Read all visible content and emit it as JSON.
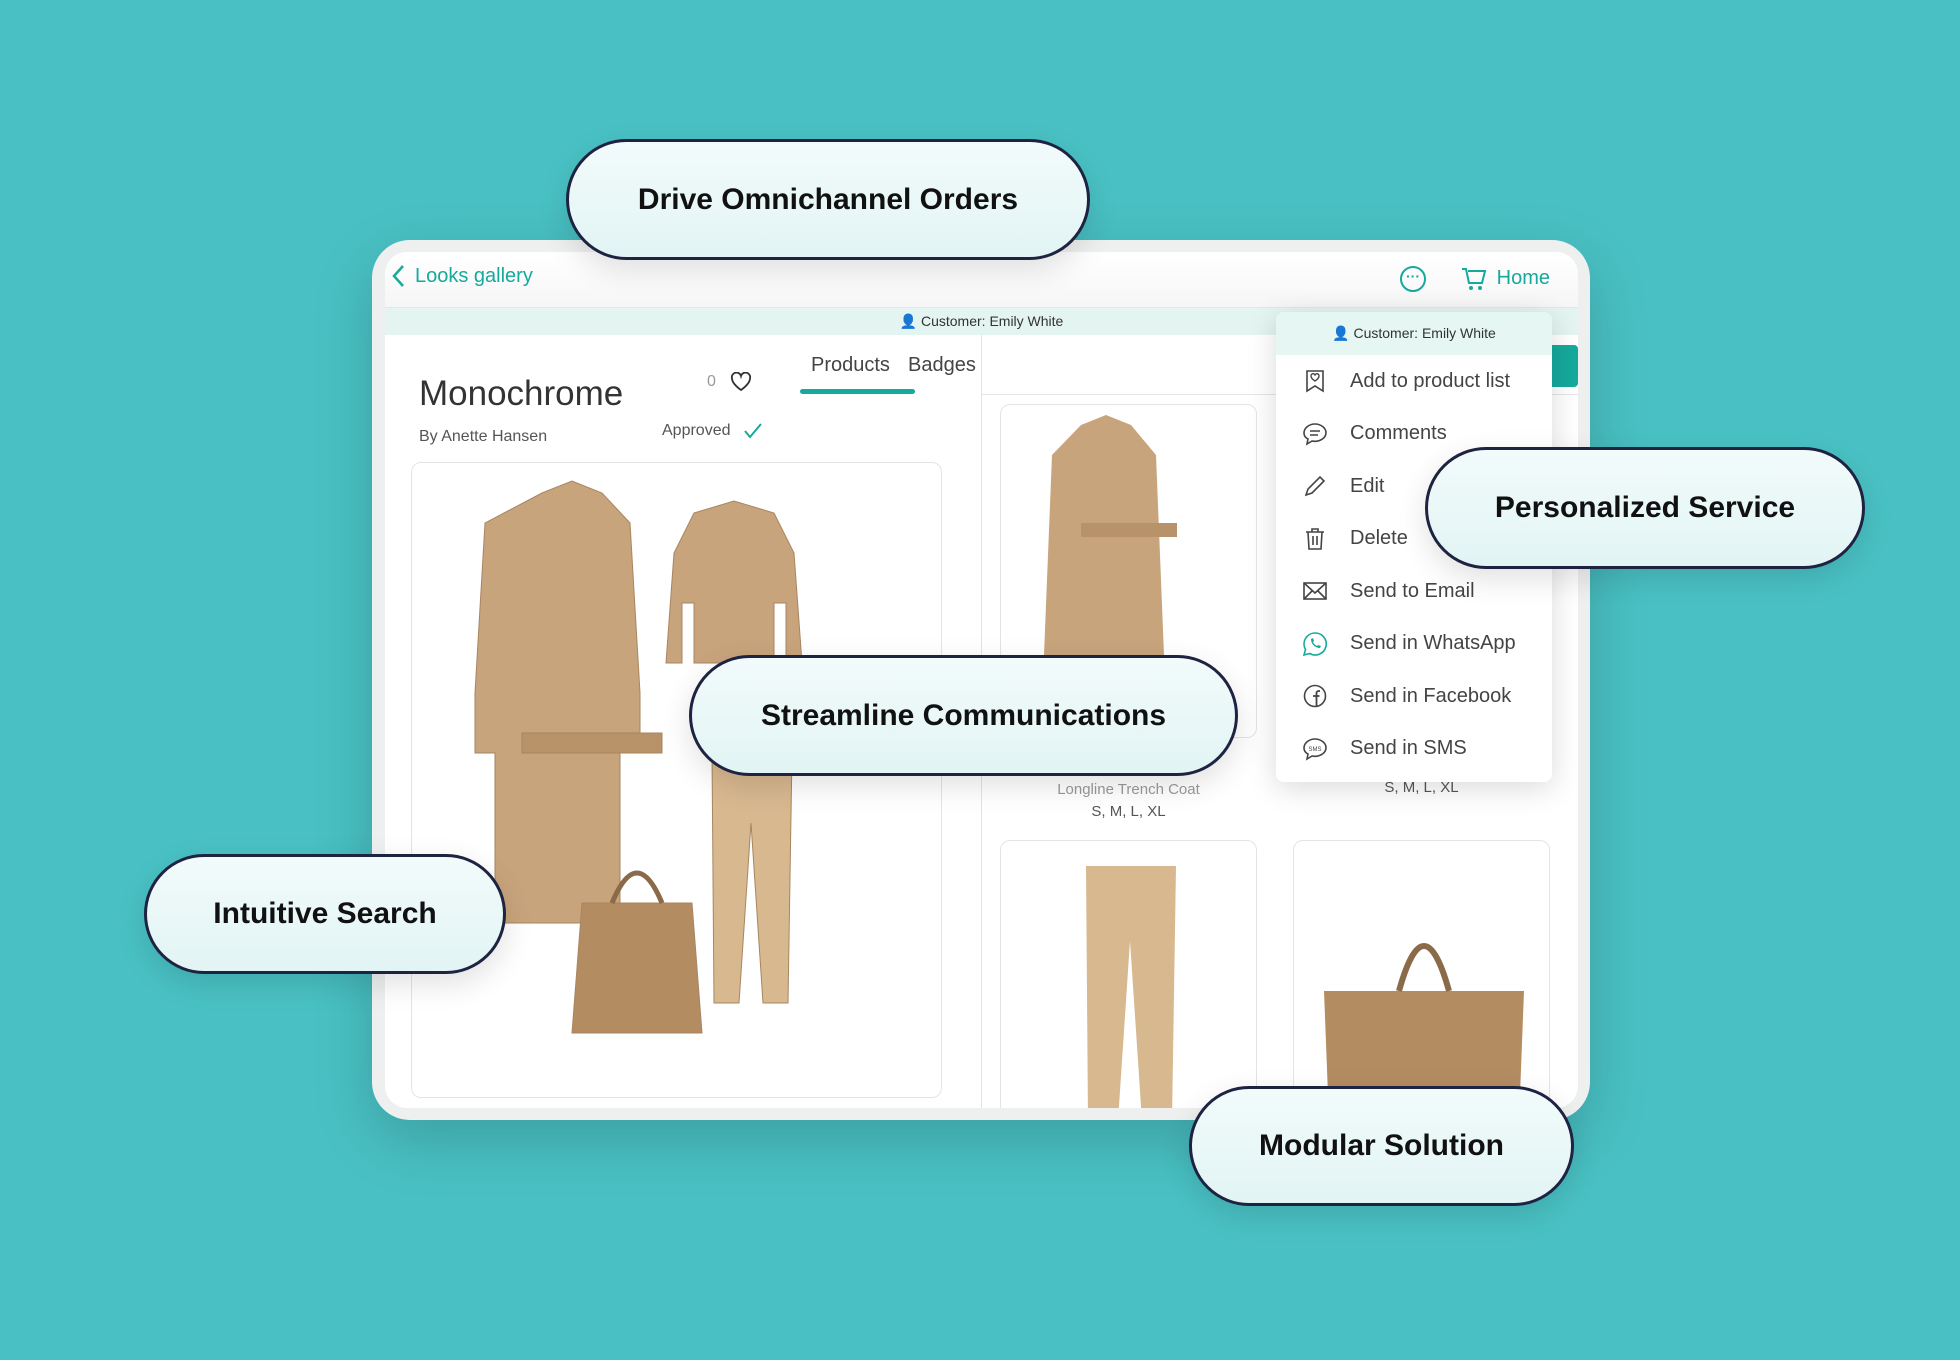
{
  "header": {
    "back_label": "Looks gallery",
    "home_label": "Home",
    "more_icon": "ellipsis-circle-icon",
    "cart_icon": "cart-icon"
  },
  "customer_bar": {
    "label": "Customer: Emily White"
  },
  "look": {
    "title": "Monochrome",
    "author": "By Anette Hansen",
    "likes": "0",
    "status": "Approved"
  },
  "tabs": [
    {
      "label": "Products",
      "active": true
    },
    {
      "label": "Badges",
      "active": false
    }
  ],
  "products": [
    {
      "name": "Longline Trench Coat",
      "sizes": "S, M, L, XL"
    },
    {
      "name": "",
      "sizes": "S, M, L, XL"
    }
  ],
  "menu": {
    "header": "Customer: Emily White",
    "items": [
      {
        "label": "Add to product list",
        "icon": "bookmark-heart-icon"
      },
      {
        "label": "Comments",
        "icon": "chat-bubble-icon"
      },
      {
        "label": "Edit",
        "icon": "pencil-icon"
      },
      {
        "label": "Delete",
        "icon": "trash-icon"
      },
      {
        "label": "Send to Email",
        "icon": "envelope-icon"
      },
      {
        "label": "Send in WhatsApp",
        "icon": "whatsapp-icon",
        "highlighted": true
      },
      {
        "label": "Send in Facebook",
        "icon": "facebook-icon"
      },
      {
        "label": "Send in SMS",
        "icon": "sms-icon"
      }
    ]
  },
  "callouts": [
    "Drive Omnichannel Orders",
    "Personalized Service",
    "Streamline Communications",
    "Intuitive Search",
    "Modular Solution"
  ],
  "colors": {
    "background": "#49c1c4",
    "accent": "#16a99c",
    "callout_border": "#1e2341",
    "product_tan": "#c8a47c"
  }
}
